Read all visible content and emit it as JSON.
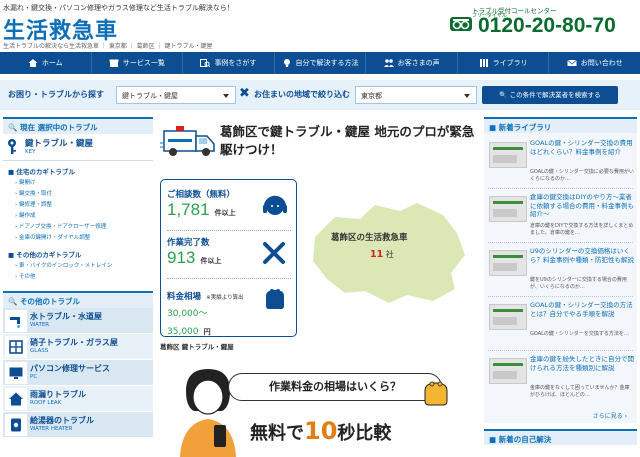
{
  "header": {
    "tagline": "水漏れ・鍵交換・パソコン修理やガラス修理など生活トラブル解決なら！",
    "logo": "生活救急車",
    "breadcrumb": "生活トラブルの解決なら生活救急車 ｜ 東京都 ｜ 葛飾区 ｜ 鍵トラブル・鍵屋",
    "phone_label": "トラブル受付コールセンター",
    "phone_free": "フリーダイヤル",
    "phone_number": "0120-20-80-70"
  },
  "nav": [
    {
      "label": "ホーム",
      "icon": "home-icon"
    },
    {
      "label": "サービス一覧",
      "icon": "box-icon"
    },
    {
      "label": "事例をさがす",
      "icon": "search-case-icon"
    },
    {
      "label": "自分で解決する方法",
      "icon": "bulb-icon"
    },
    {
      "label": "お客さまの声",
      "icon": "people-icon"
    },
    {
      "label": "ライブラリ",
      "icon": "library-icon"
    },
    {
      "label": "お問い合わせ",
      "icon": "mail-icon"
    }
  ],
  "search": {
    "trouble_label": "お困り・トラブルから探す",
    "trouble_value": "鍵トラブル・鍵屋",
    "area_label": "お住まいの地域で絞り込む",
    "area_value": "東京都",
    "button": "この条件で解決業者を検索する"
  },
  "left": {
    "current_head": "現在 選択中のトラブル",
    "current_title": "鍵トラブル・鍵屋",
    "current_sub": "KEY",
    "cat1": "住宅のカギトラブル",
    "cat1_items": [
      "鍵開け",
      "鍵交換・取付",
      "鍵修理・調整",
      "鍵作成",
      "ドアノブ交換・ドアクローザー修理",
      "金庫の鍵開け・ダイヤル調整"
    ],
    "cat2": "その他のカギトラブル",
    "cat2_items": [
      "車・バイクのインロック・メトレイン",
      "その他"
    ],
    "other_head": "その他のトラブル",
    "others": [
      {
        "title": "水トラブル・水道屋",
        "sub": "WATER"
      },
      {
        "title": "硝子トラブル・ガラス屋",
        "sub": "GLASS"
      },
      {
        "title": "パソコン修理サービス",
        "sub": "PC"
      },
      {
        "title": "雨漏りトラブル",
        "sub": "ROOF LEAK"
      },
      {
        "title": "給湯器のトラブル",
        "sub": "WATER HEATER"
      }
    ]
  },
  "center": {
    "hero_title": "葛飾区で鍵トラブル・鍵屋 地元のプロが緊急駆けつけ！",
    "stat1_label": "ご相談数（無料）",
    "stat1_value": "1,781",
    "stat1_unit": "件以上",
    "stat2_label": "作業完了数",
    "stat2_value": "913",
    "stat2_unit": "件以上",
    "stat3_label": "料金相場",
    "stat3_note": "※実績より算出",
    "stat3_value": "30,000〜",
    "stat3_value2": "35,000",
    "stat3_unit": "円",
    "map_title": "葛飾区の生活救急車",
    "map_count": "11",
    "map_unit": "社",
    "section_title": "葛飾区 鍵トラブル・鍵屋",
    "banner_bubble": "作業料金の相場はいくら？",
    "banner_big1": "無料で",
    "banner_big2": "10",
    "banner_big3": "秒比較"
  },
  "right": {
    "lib_head": "新着ライブラリ",
    "lib": [
      {
        "title": "GOALの鍵・シリンダー交換の費用はどれくらい？料金事例を紹介",
        "desc": "GOALの鍵・シリンダー交換に必要な費用がいくらになるのか…"
      },
      {
        "title": "倉庫の鍵交換はDIYのやり方〜業者に依頼する場合の費用・料金事例も紹介〜",
        "desc": "倉庫の鍵をDIYで交換する方法を詳しくまとめました。倉庫の鍵を…"
      },
      {
        "title": "U9のシリンダーの交換価格はいくら？料金事例や種類・防犯性も解説",
        "desc": "鍵をU9のシリンダーに交換する場合の費用が、いくらになるのか…"
      },
      {
        "title": "GOALの鍵・シリンダー交換の方法とは？自分でやる手順を解説",
        "desc": "GOALの鍵・シリンダーを交換する方法を…"
      },
      {
        "title": "金庫の鍵を紛失したときに自分で開けられる方法を種類別に解説",
        "desc": "金庫の鍵をなくして困っていませんか？金庫がひらけば、ほとんどの…"
      }
    ],
    "more": "さらに見る",
    "case_head": "新着の自己解決"
  }
}
